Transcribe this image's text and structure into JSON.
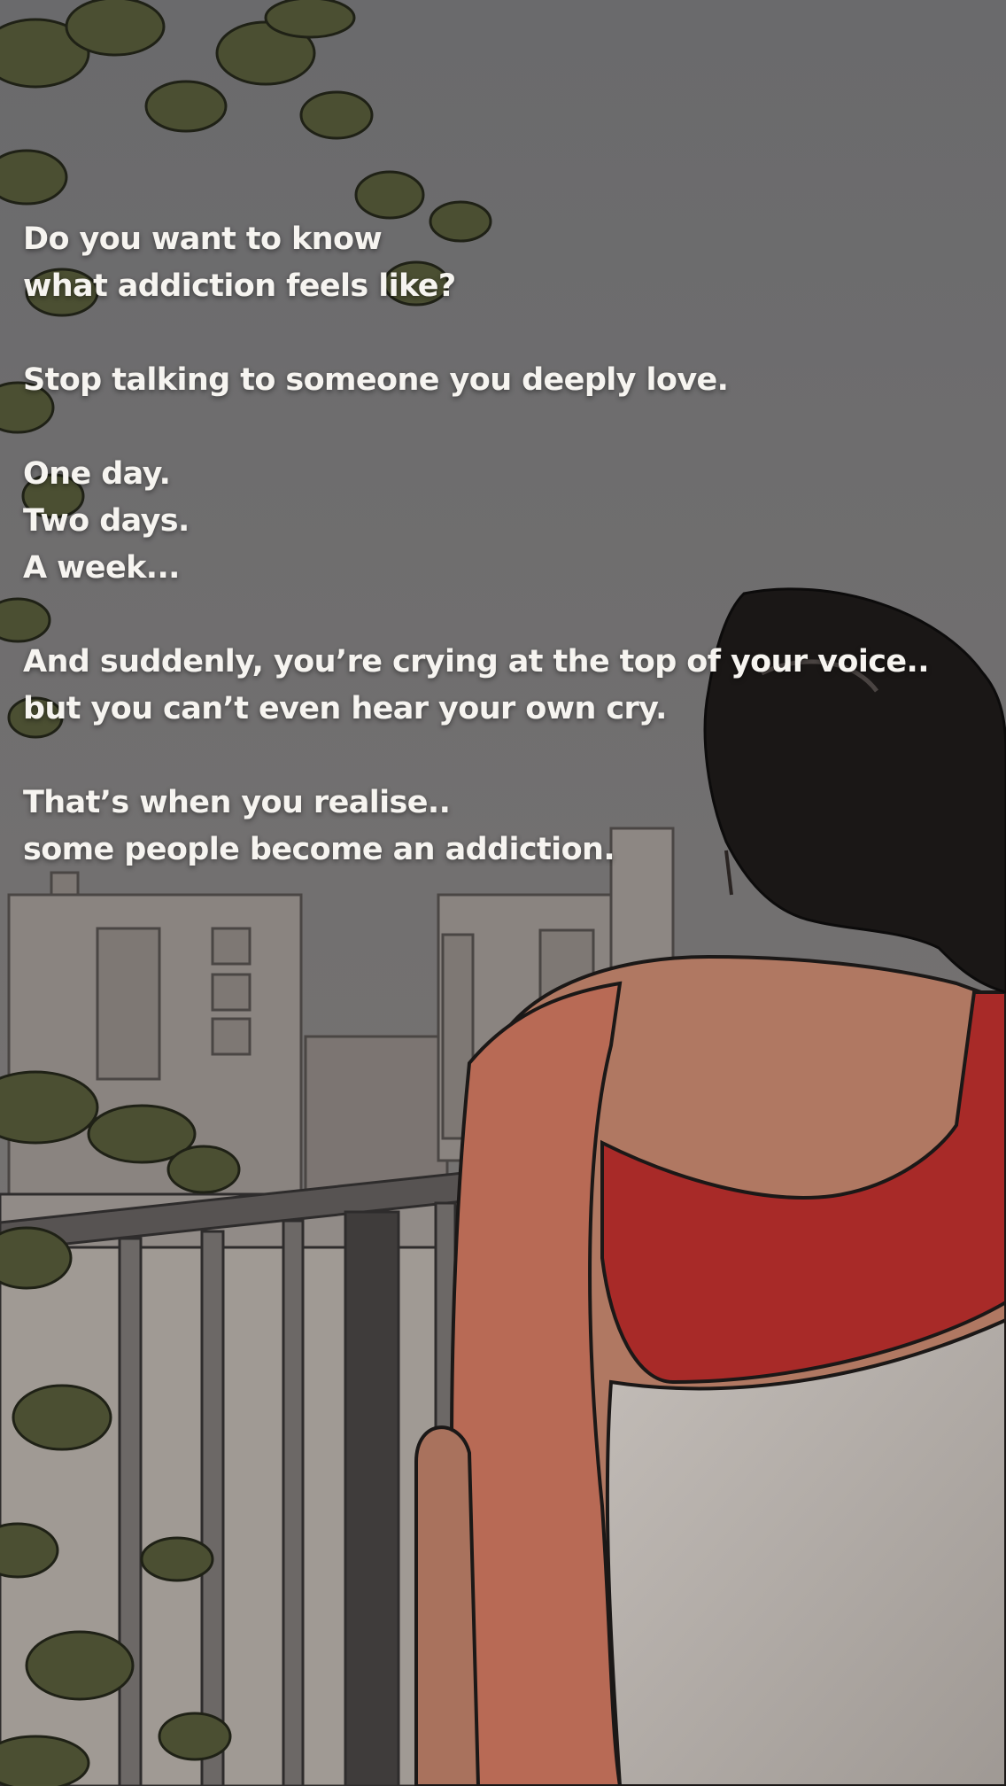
{
  "quote": {
    "stanza1": [
      "Do you want to know",
      "what addiction feels like?"
    ],
    "stanza2": [
      "Stop talking to someone you deeply love."
    ],
    "stanza3": [
      "One day.",
      "Two days.",
      "A week..."
    ],
    "stanza4": [
      "And suddenly, you’re crying at the top of your voice..",
      "but you can’t even hear your own cry."
    ],
    "stanza5": [
      "That’s when you realise..",
      "some people become an addiction."
    ]
  },
  "colors": {
    "sky": "#6e6e70",
    "buildings": "#8a8480",
    "foliage": "#4b4f32",
    "hair": "#1a1716",
    "skin": "#b07862",
    "blouse": "#a82a28",
    "saree": "#b4aeaa",
    "text": "#f6f4f0"
  }
}
